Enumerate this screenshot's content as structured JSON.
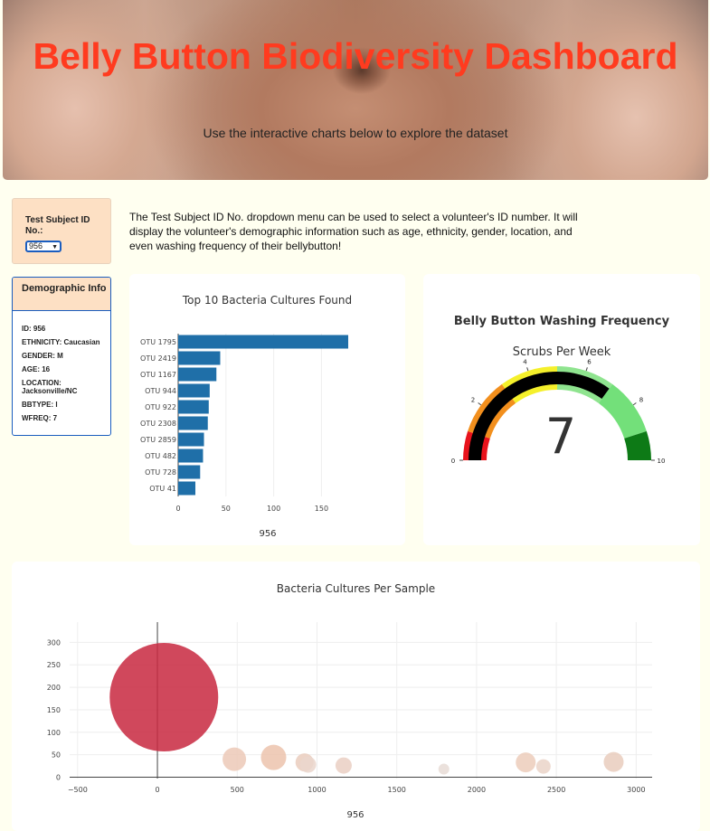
{
  "header": {
    "title": "Belly Button Biodiversity Dashboard",
    "subtitle": "Use the interactive charts below to explore the dataset"
  },
  "selector": {
    "label": "Test Subject ID No.:",
    "value": "956"
  },
  "intro": "The Test Subject ID No. dropdown menu can be used to select a volunteer's ID number. It will display the volunteer's demographic information such as age, ethnicity, gender, location, and even washing frequency of their bellybutton!",
  "demographics": {
    "title": "Demographic Info",
    "rows": [
      "ID: 956",
      "ETHNICITY: Caucasian",
      "GENDER: M",
      "AGE: 16",
      "LOCATION: Jacksonville/NC",
      "BBTYPE: I",
      "WFREQ: 7"
    ]
  },
  "chart_data": [
    {
      "type": "bar",
      "orientation": "horizontal",
      "title": "Top 10 Bacteria Cultures Found",
      "xlabel": "956",
      "categories": [
        "OTU 1795",
        "OTU 2419",
        "OTU 1167",
        "OTU 944",
        "OTU 922",
        "OTU 2308",
        "OTU 2859",
        "OTU 482",
        "OTU 728",
        "OTU 41"
      ],
      "values": [
        178,
        44,
        40,
        33,
        32,
        31,
        27,
        26,
        23,
        18
      ],
      "xticks": [
        0,
        50,
        100,
        150
      ],
      "xlim": [
        0,
        178
      ],
      "color": "#1f6fa8"
    },
    {
      "type": "gauge",
      "title": "Belly Button Washing Frequency",
      "subtitle": "Scrubs Per Week",
      "value": 7,
      "range": [
        0,
        10
      ],
      "ticks": [
        0,
        2,
        4,
        6,
        8,
        10
      ],
      "bands": [
        {
          "range": [
            0,
            1
          ],
          "color": "#e8131c"
        },
        {
          "range": [
            1,
            3
          ],
          "color": "#f28f1d"
        },
        {
          "range": [
            3,
            5
          ],
          "color": "#f5f02b"
        },
        {
          "range": [
            5,
            7
          ],
          "color": "#8fe48f"
        },
        {
          "range": [
            7,
            9
          ],
          "color": "#73e07a"
        },
        {
          "range": [
            9,
            10
          ],
          "color": "#0d7a16"
        }
      ],
      "bar_color": "#000000"
    },
    {
      "type": "scatter",
      "subtype": "bubble",
      "title": "Bacteria Cultures Per Sample",
      "xlabel": "956",
      "xlim": [
        -550,
        3100
      ],
      "ylim": [
        -3,
        345
      ],
      "xticks": [
        -500,
        0,
        500,
        1000,
        1500,
        2000,
        2500,
        3000
      ],
      "yticks": [
        0,
        50,
        100,
        150,
        200,
        250,
        300
      ],
      "points": [
        {
          "x": 41,
          "y": 178,
          "r": 60,
          "color": "#c8283f"
        },
        {
          "x": 482,
          "y": 40,
          "r": 13,
          "color": "#ecc9b7"
        },
        {
          "x": 728,
          "y": 44,
          "r": 14,
          "color": "#ecc3ad"
        },
        {
          "x": 922,
          "y": 33,
          "r": 10,
          "color": "#eaccbd"
        },
        {
          "x": 944,
          "y": 28,
          "r": 9,
          "color": "#ead6cc"
        },
        {
          "x": 1167,
          "y": 26,
          "r": 9,
          "color": "#eacfc3"
        },
        {
          "x": 1795,
          "y": 18,
          "r": 6,
          "color": "#e8dcd6"
        },
        {
          "x": 2308,
          "y": 33,
          "r": 11,
          "color": "#ecccbb"
        },
        {
          "x": 2419,
          "y": 24,
          "r": 8,
          "color": "#ead4c8"
        },
        {
          "x": 2859,
          "y": 34,
          "r": 11,
          "color": "#e9cdbd"
        }
      ]
    }
  ]
}
